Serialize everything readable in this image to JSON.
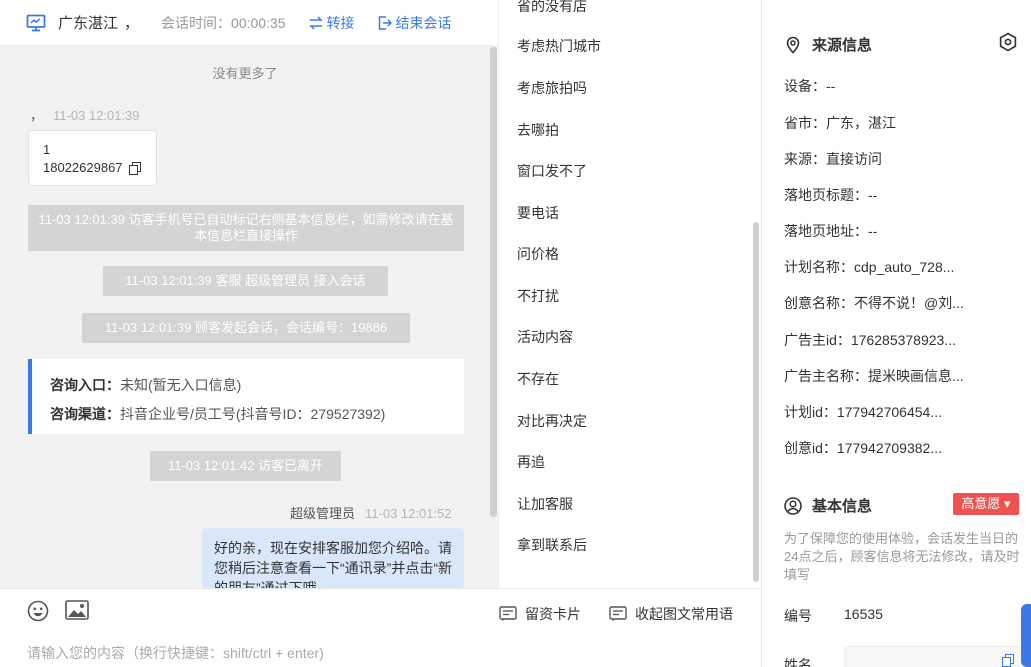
{
  "header": {
    "region": "广东湛江",
    "separator": "，",
    "session_time": "会话时间：00:00:35",
    "transfer_label": "转接",
    "end_label": "结束会话"
  },
  "chat": {
    "no_more": "没有更多了",
    "visitor_msg": {
      "sender": "，",
      "time": "11-03 12:01:39",
      "line1": "1",
      "phone": "18022629867"
    },
    "system_messages": [
      "11-03 12:01:39 访客手机号已自动标记右侧基本信息栏，如需修改请在基本信息栏直接操作",
      "11-03 12:01:39 客服 超级管理员 接入会话",
      "11-03 12:01:39 顾客发起会话，会话编号：19886"
    ],
    "entry_card": {
      "entry_label": "咨询入口：",
      "entry_value": "未知(暂无入口信息)",
      "channel_label": "咨询渠道：",
      "channel_value": "抖音企业号/员工号(抖音号ID：279527392)"
    },
    "left_message": "11-03 12:01:42 访客已离开",
    "agent_msg": {
      "sender": "超级管理员",
      "time": "11-03 12:01:52",
      "text": "好的亲，现在安排客服加您介绍哈。请您稍后注意查看一下“通讯录”并点击“新的朋友”通过下哦"
    }
  },
  "composer": {
    "card_label": "留资卡片",
    "collapse_label": "收起图文常用语",
    "placeholder": "请输入您的内容（换行快捷键：shift/ctrl + enter)"
  },
  "quick_replies": [
    "省的没有店",
    "考虑热门城市",
    "考虑旅拍吗",
    "去哪拍",
    "窗口发不了",
    "要电话",
    "问价格",
    "不打扰",
    "活动内容",
    "不存在",
    "对比再决定",
    "再追",
    "让加客服",
    "拿到联系后"
  ],
  "source_info": {
    "title": "来源信息",
    "rows": [
      "设备：--",
      "省市：广东，湛江",
      "来源：直接访问",
      "落地页标题：--",
      "落地页地址：--",
      "计划名称：cdp_auto_728...",
      "创意名称：不得不说！@刘...",
      "广告主id：176285378923...",
      "广告主名称：提米映画信息...",
      "计划id：177942706454...",
      "创意id：177942709382..."
    ]
  },
  "basic_info": {
    "title": "基本信息",
    "intent_badge": "高意愿 ▾",
    "notice": "为了保障您的使用体验，会话发生当日的24点之后，顾客信息将无法修改，请及时填写",
    "id_label": "编号",
    "id_value": "16535",
    "name_label": "姓名"
  },
  "colors": {
    "accent": "#3b7ae6",
    "danger": "#f05252",
    "bubble": "#d9e7fb"
  }
}
